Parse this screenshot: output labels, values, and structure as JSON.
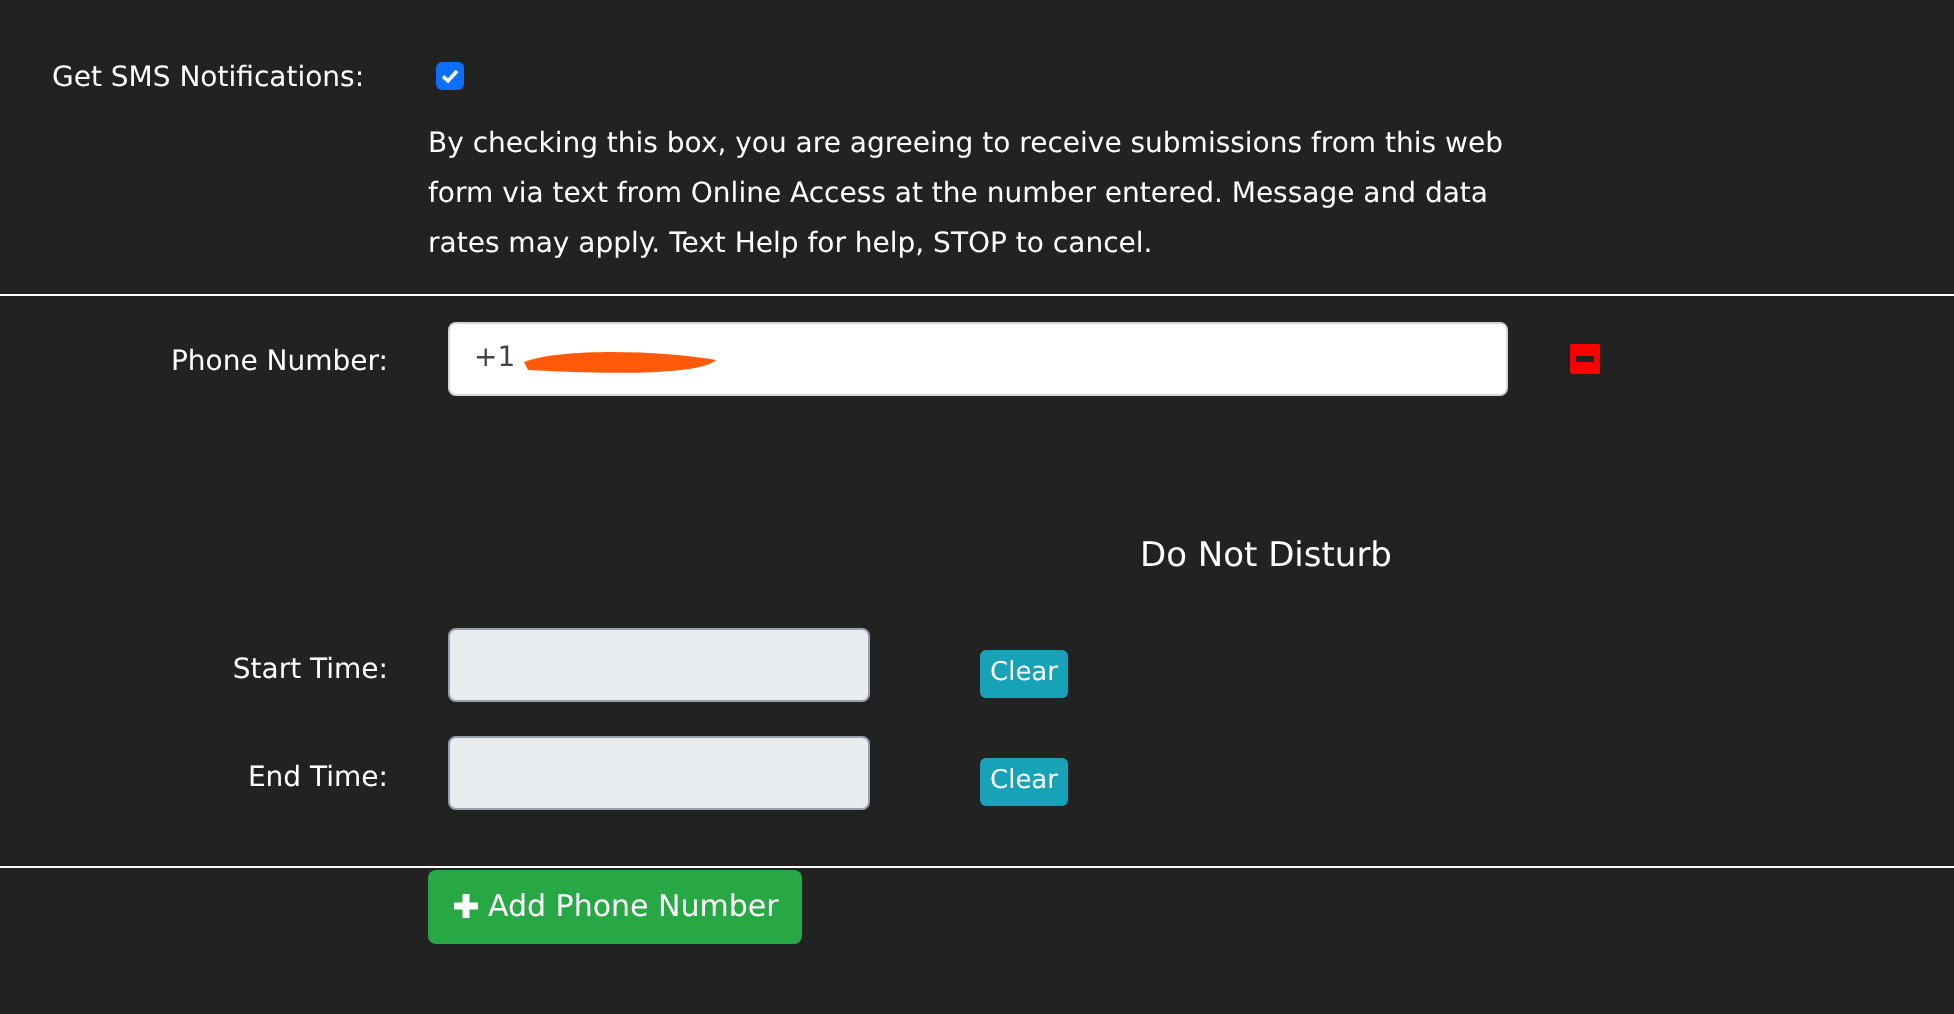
{
  "sms": {
    "label": "Get SMS Notifications:",
    "checked": true,
    "consent": "By checking this box, you are agreeing to receive submissions from this web form via text from Online Access at the number entered. Message and data rates may apply. Text Help for help, STOP to cancel."
  },
  "phone": {
    "label": "Phone Number:",
    "value": "+1",
    "redacted": true
  },
  "do_not_disturb": {
    "title": "Do Not Disturb",
    "rows": [
      {
        "label": "Start Time:",
        "button": "Clear"
      },
      {
        "label": "End Time:",
        "button": "Clear"
      }
    ]
  },
  "add_button": "Add Phone Number"
}
